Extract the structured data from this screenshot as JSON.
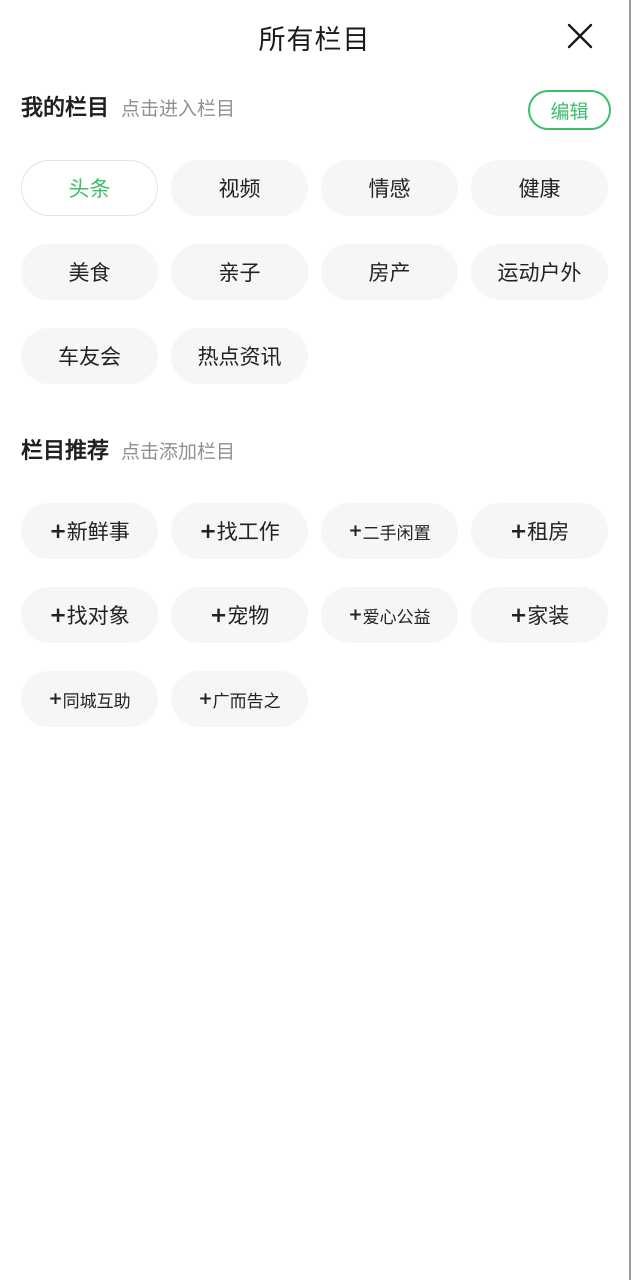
{
  "header": {
    "title": "所有栏目",
    "close_icon": "close-icon"
  },
  "colors": {
    "accent": "#3cbf6b",
    "chip_bg": "#f5f6f8",
    "text": "#222222",
    "hint": "#8e9094"
  },
  "my_channels": {
    "title": "我的栏目",
    "hint": "点击进入栏目",
    "edit_label": "编辑",
    "items": [
      {
        "label": "头条",
        "active": true
      },
      {
        "label": "视频"
      },
      {
        "label": "情感"
      },
      {
        "label": "健康"
      },
      {
        "label": "美食"
      },
      {
        "label": "亲子"
      },
      {
        "label": "房产"
      },
      {
        "label": "运动户外"
      },
      {
        "label": "车友会"
      },
      {
        "label": "热点资讯"
      }
    ]
  },
  "recommended": {
    "title": "栏目推荐",
    "hint": "点击添加栏目",
    "prefix": "+",
    "items": [
      {
        "label": "新鲜事"
      },
      {
        "label": "找工作"
      },
      {
        "label": "二手闲置",
        "small": true
      },
      {
        "label": "租房"
      },
      {
        "label": "找对象"
      },
      {
        "label": "宠物"
      },
      {
        "label": "爱心公益",
        "small": true
      },
      {
        "label": "家装"
      },
      {
        "label": "同城互助",
        "small": true
      },
      {
        "label": "广而告之",
        "small": true
      }
    ]
  }
}
